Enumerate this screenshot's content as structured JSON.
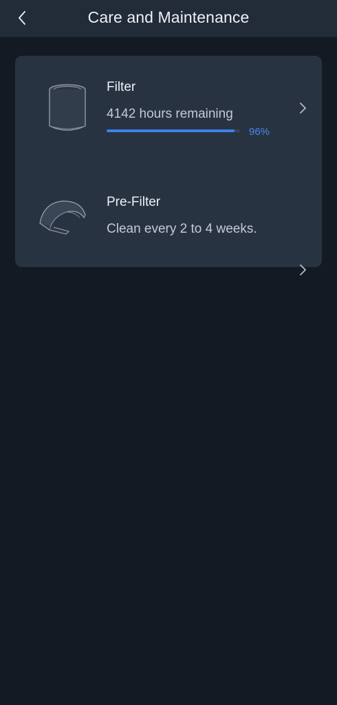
{
  "header": {
    "title": "Care and Maintenance",
    "back_icon": "chevron-left-icon"
  },
  "items": [
    {
      "name": "Filter",
      "description": "4142 hours remaining",
      "progress_percent": 96,
      "progress_label": "96%",
      "icon": "cylinder-filter-icon"
    },
    {
      "name": "Pre-Filter",
      "description": "Clean every 2 to 4 weeks.",
      "icon": "curved-mesh-icon"
    }
  ],
  "colors": {
    "background": "#131a24",
    "header": "#222b38",
    "card": "#283342",
    "accent": "#3f80ec"
  }
}
